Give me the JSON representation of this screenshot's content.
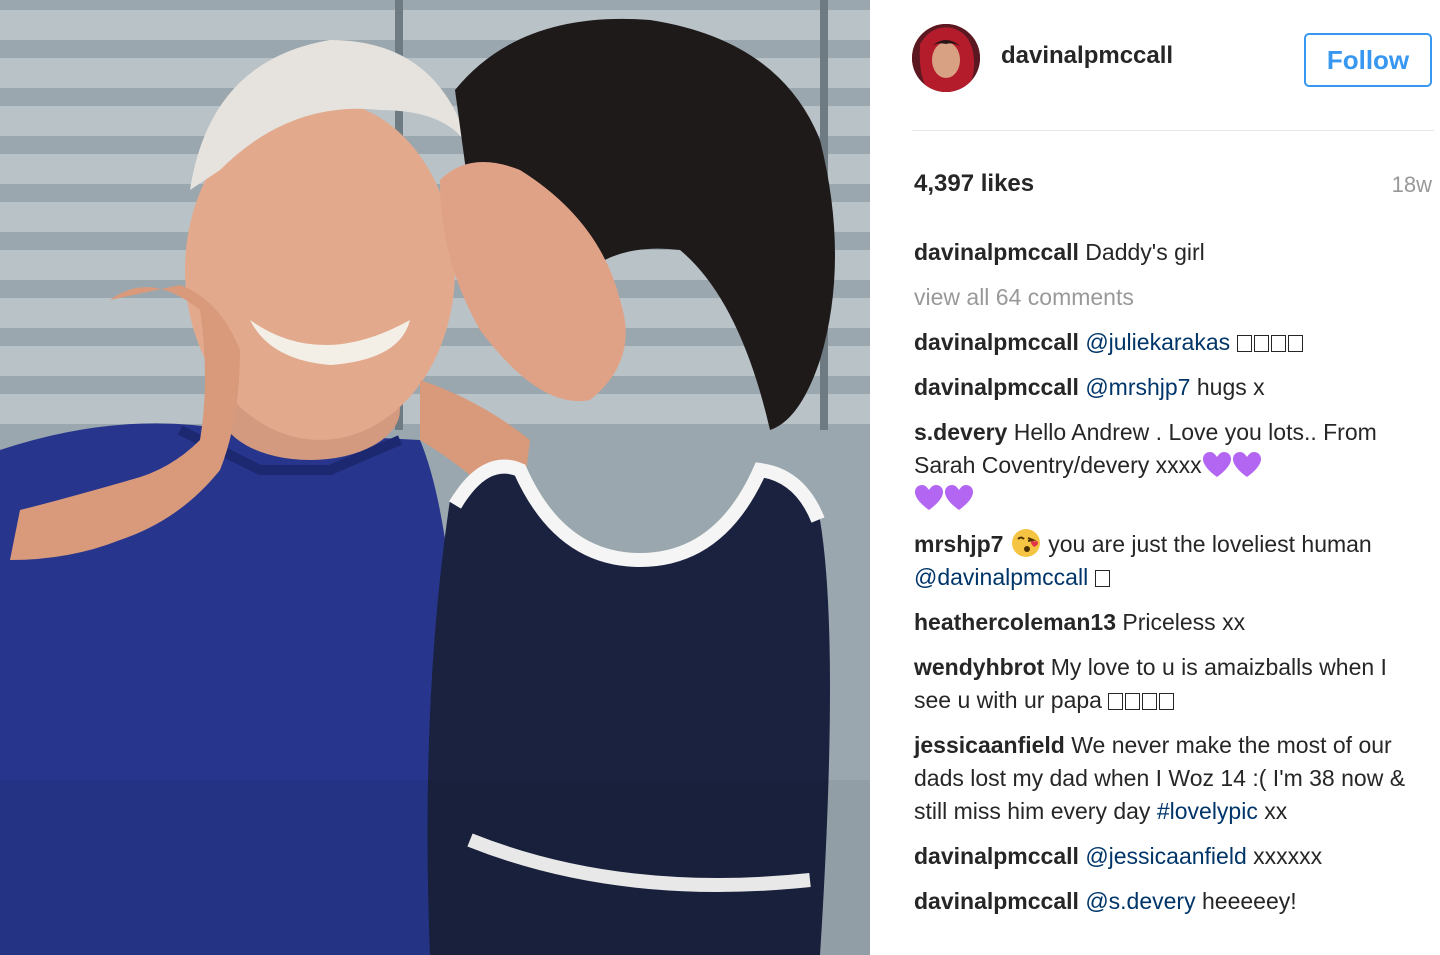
{
  "post": {
    "username": "davinalpmccall",
    "follow_label": "Follow",
    "likes": "4,397 likes",
    "age": "18w",
    "caption": {
      "username": "davinalpmccall",
      "text": " Daddy's girl"
    },
    "view_all": "view all 64 comments"
  },
  "comments": [
    {
      "username": "davinalpmccall",
      "mention": "@juliekarakas",
      "text": "",
      "boxes": 4
    },
    {
      "username": "davinalpmccall",
      "mention": "@mrshjp7",
      "text": " hugs x"
    },
    {
      "username": "s.devery",
      "text_a": " Hello Andrew . Love you lots.. From Sarah Coventry/devery xxxx",
      "hearts": 4
    },
    {
      "username": "mrshjp7",
      "text_a": " you are just the loveliest human ",
      "mention": "@davinalpmccall",
      "boxes": 1
    },
    {
      "username": "heathercoleman13",
      "text": " Priceless xx"
    },
    {
      "username": "wendyhbrot",
      "text": " My love to u is amaizballs when I see u with ur papa ",
      "boxes": 4
    },
    {
      "username": "jessicaanfield",
      "text": " We never make the most of our dads lost my dad when I Woz 14 :( I'm 38 now & still miss him every day ",
      "hashtag": "#lovelypic",
      "tail": " xx"
    },
    {
      "username": "davinalpmccall",
      "mention": "@jessicaanfield",
      "text": " xxxxxx"
    },
    {
      "username": "davinalpmccall",
      "mention": "@s.devery",
      "text": " heeeeey!"
    }
  ],
  "colors": {
    "accent": "#3897f0",
    "mention": "#003569",
    "muted": "#999999",
    "heart": "#b266f2"
  },
  "icons": {
    "heart": "purple-heart-emoji",
    "kiss": "face-blowing-kiss-emoji"
  }
}
